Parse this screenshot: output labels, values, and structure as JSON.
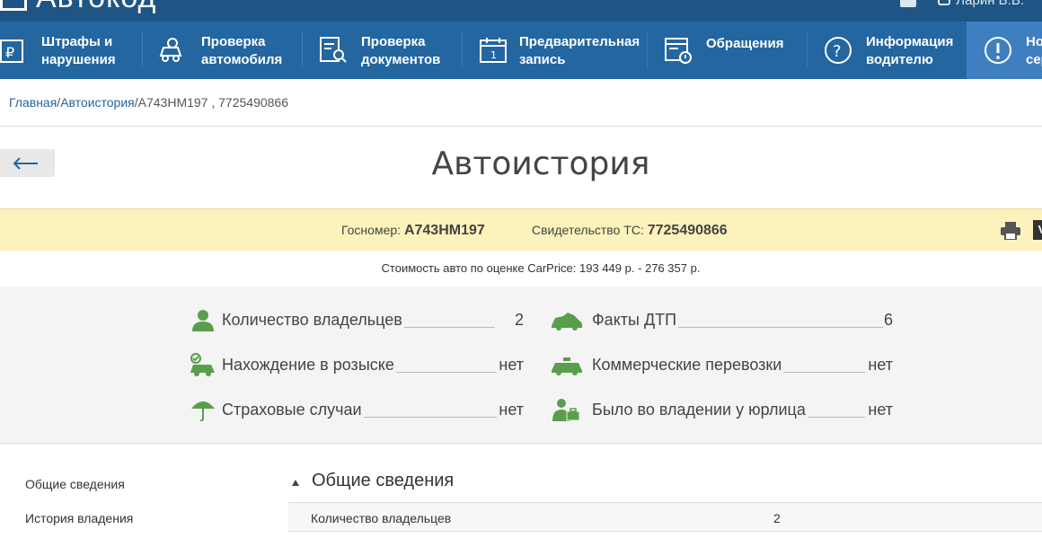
{
  "header": {
    "logo_text": "Автокод",
    "user_name": "Ларин В.В."
  },
  "nav": [
    {
      "label": "Штрафы и\nнарушения",
      "icon": "ruble-doc-icon"
    },
    {
      "label": "Проверка\nавтомобиля",
      "icon": "car-search-icon"
    },
    {
      "label": "Проверка\nдокументов",
      "icon": "doc-search-icon"
    },
    {
      "label": "Предварительная\nзапись",
      "icon": "calendar-icon"
    },
    {
      "label": "Обращения",
      "icon": "request-icon"
    },
    {
      "label": "Информация\nводителю",
      "icon": "question-icon"
    },
    {
      "label": "Но\nсер",
      "icon": "alert-icon"
    }
  ],
  "breadcrumb": {
    "home": "Главная",
    "sep1": "/",
    "section": "Автоистория",
    "sep2": "/",
    "current": "A743HM197 , 7725490866"
  },
  "page_title": "Автоистория",
  "vehicle": {
    "plate_label": "Госномер:",
    "plate": "A743HM197",
    "cert_label": "Свидетельство ТС:",
    "cert": "7725490866",
    "v_button": "V"
  },
  "price_text": "Стоимость авто по оценке CarPrice: 193 449 р. - 276 357 р.",
  "summary": {
    "owners": {
      "label": "Количество владельцев",
      "value": "2"
    },
    "wanted": {
      "label": "Нахождение в розыске",
      "value": "нет"
    },
    "insurance": {
      "label": "Страховые случаи",
      "value": "нет"
    },
    "accidents": {
      "label": "Факты ДТП",
      "value": "6"
    },
    "commercial": {
      "label": "Коммерческие перевозки",
      "value": "нет"
    },
    "legal": {
      "label": "Было во владении у юрлица",
      "value": "нет"
    }
  },
  "sidebar": {
    "general": "Общие сведения",
    "ownership": "История владения"
  },
  "section": {
    "title": "Общие сведения",
    "rows": [
      {
        "label": "Количество владельцев",
        "value": "2"
      }
    ]
  },
  "colors": {
    "header": "#1e5585",
    "nav": "#2466a0",
    "nav_active": "#3f7fc0",
    "band": "#fcf3bc",
    "icon_green": "#5a9e4b"
  }
}
